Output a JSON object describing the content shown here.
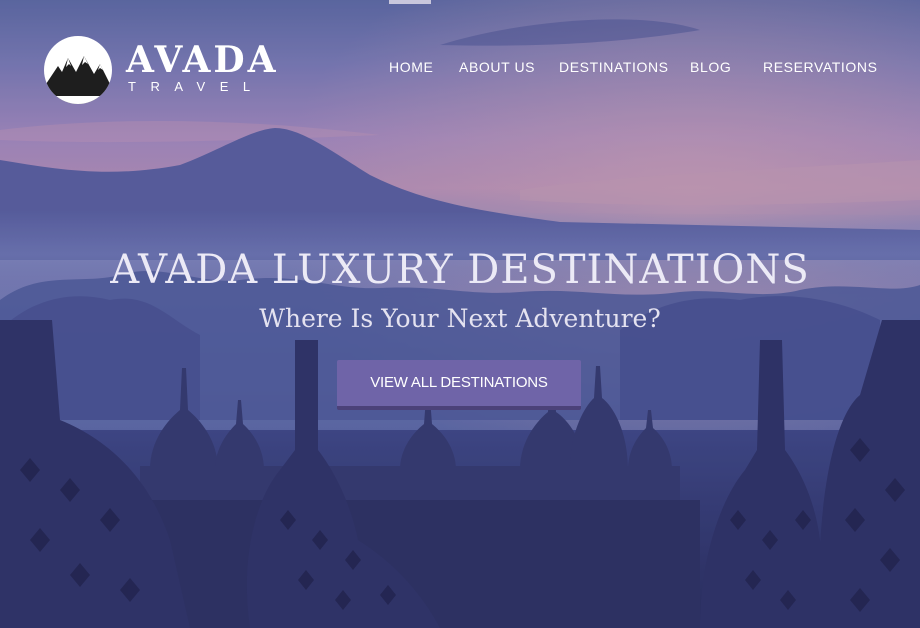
{
  "header": {
    "logo": {
      "title": "AVADA",
      "subtitle": "TRAVEL"
    },
    "nav": [
      {
        "label": "HOME",
        "active": true
      },
      {
        "label": "ABOUT US",
        "active": false
      },
      {
        "label": "DESTINATIONS",
        "active": false
      },
      {
        "label": "BLOG",
        "active": false
      },
      {
        "label": "RESERVATIONS",
        "active": false
      }
    ]
  },
  "hero": {
    "title": "AVADA LUXURY DESTINATIONS",
    "subtitle": "Where Is Your Next Adventure?",
    "cta_label": "VIEW ALL DESTINATIONS"
  },
  "colors": {
    "accent": "#6f64a8",
    "accent_dark": "#4b4179",
    "sky_top": "#5e6aa2",
    "sky_dusk": "#b48cb8",
    "temple_shadow": "#2a2c5c"
  }
}
